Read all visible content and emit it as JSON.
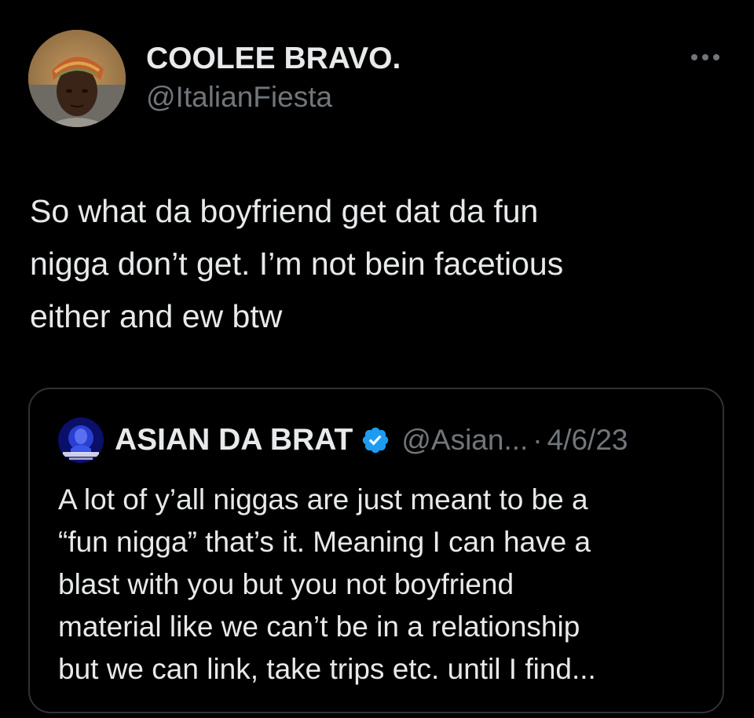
{
  "tweet": {
    "author": {
      "display_name": "COOLEE BRAVO.",
      "handle": "@ItalianFiesta",
      "avatar_icon": "user-avatar-photo"
    },
    "more_icon": "more-horizontal-icon",
    "text_lines": [
      "So what da boyfriend get dat da fun",
      "nigga don’t get. I’m not bein facetious",
      "either and ew btw"
    ]
  },
  "quoted_tweet": {
    "author": {
      "display_name": "ASIAN DA BRAT",
      "verified_icon": "verified-badge-icon",
      "handle": "@Asian...",
      "avatar_icon": "user-avatar-photo"
    },
    "separator": "·",
    "date": "4/6/23",
    "text_lines": [
      "A lot of y’all niggas are just meant to be  a",
      "“fun nigga” that’s it. Meaning I can have a",
      "blast with you but you not boyfriend",
      "material like we can’t be in a relationship",
      "but we can link, take trips etc. until I find..."
    ]
  },
  "colors": {
    "background": "#000000",
    "primary_text": "#e7e9ea",
    "secondary_text": "#71767b",
    "border": "#2f3336",
    "verified_blue": "#1d9bf0"
  }
}
